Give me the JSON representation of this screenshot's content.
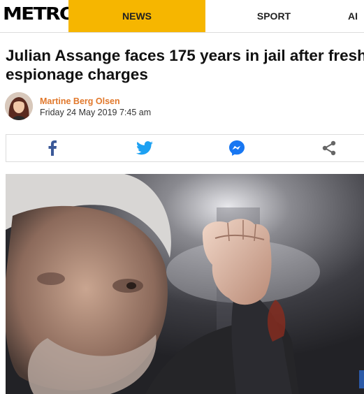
{
  "header": {
    "logo": "METRO",
    "nav": [
      {
        "label": "NEWS",
        "active": true
      },
      {
        "label": "SPORT",
        "active": false
      },
      {
        "label": "AI",
        "active": false
      }
    ],
    "accent_color": "#f6b600"
  },
  "article": {
    "headline_line1": "Julian Assange faces 175 years in jail after fresh",
    "headline_line2": "espionage charges",
    "author": {
      "name": "Martine Berg Olsen",
      "date": "Friday 24 May 2019 7:45 am",
      "name_color": "#e1782b"
    },
    "share": [
      {
        "icon": "facebook-icon",
        "color": "#3b5998"
      },
      {
        "icon": "twitter-icon",
        "color": "#1da1f2"
      },
      {
        "icon": "messenger-icon",
        "color": "#1877f2"
      },
      {
        "icon": "share-icon",
        "color": "#666666"
      }
    ],
    "hero_image": "photo-of-man-raising-fist-behind-van-window"
  }
}
